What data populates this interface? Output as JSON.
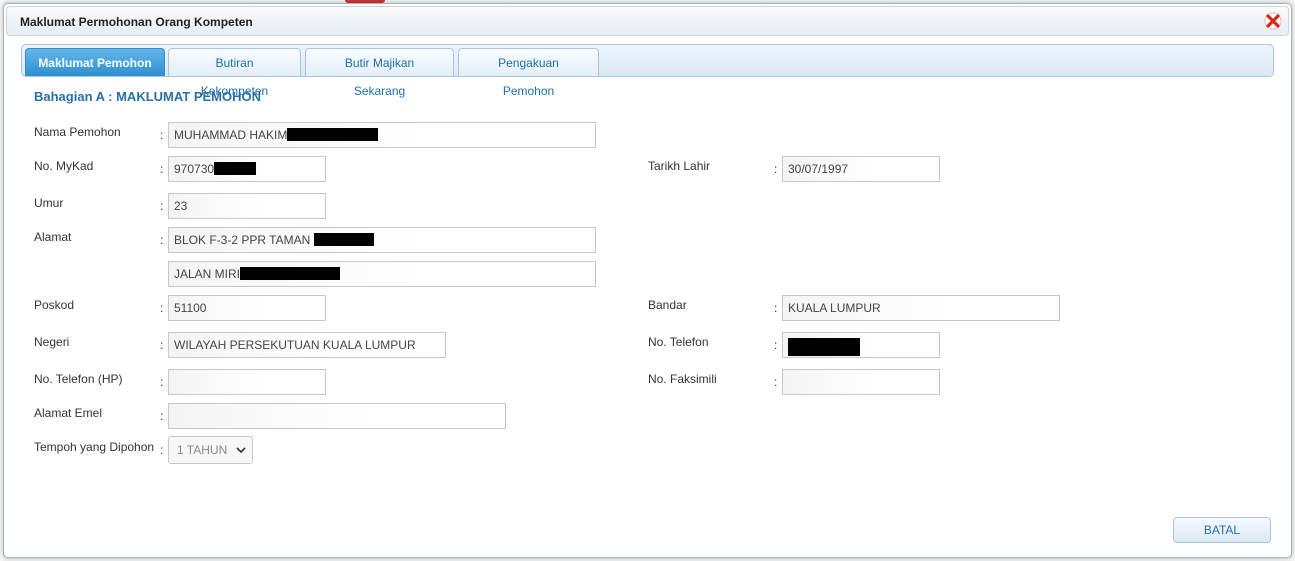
{
  "dialog": {
    "title": "Maklumat Permohonan Orang Kompeten",
    "close_icon": "close-icon",
    "colors": {
      "accent": "#2f8fd1",
      "close": "#d9261c",
      "heading": "#2a6fa8"
    }
  },
  "tabs": [
    {
      "label": "Maklumat Pemohon",
      "active": true
    },
    {
      "label": "Butiran Kekompeten",
      "active": false
    },
    {
      "label": "Butir Majikan Sekarang",
      "active": false
    },
    {
      "label": "Pengakuan Pemohon",
      "active": false
    }
  ],
  "section_title": "Bahagian A : MAKLUMAT PEMOHON",
  "colon": ":",
  "fields": {
    "nama": {
      "label": "Nama Pemohon",
      "value": "MUHAMMAD HAKIM"
    },
    "mykad": {
      "label": "No. MyKad",
      "value": "970730"
    },
    "tarikh_lahir": {
      "label": "Tarikh Lahir",
      "value": "30/07/1997"
    },
    "umur": {
      "label": "Umur",
      "value": "23"
    },
    "alamat": {
      "label": "Alamat",
      "line1": "BLOK F-3-2 PPR TAMAN",
      "line2": "JALAN MIRI"
    },
    "poskod": {
      "label": "Poskod",
      "value": "51100"
    },
    "bandar": {
      "label": "Bandar",
      "value": "KUALA LUMPUR"
    },
    "negeri": {
      "label": "Negeri",
      "value": "WILAYAH PERSEKUTUAN KUALA LUMPUR"
    },
    "telefon": {
      "label": "No. Telefon",
      "value": ""
    },
    "telefon_hp": {
      "label": "No. Telefon (HP)",
      "value": ""
    },
    "faksimili": {
      "label": "No. Faksimili",
      "value": ""
    },
    "emel": {
      "label": "Alamat Emel",
      "value": ""
    },
    "tempoh": {
      "label": "Tempoh yang Dipohon",
      "selected": "1 TAHUN"
    }
  },
  "buttons": {
    "batal": "BATAL"
  }
}
